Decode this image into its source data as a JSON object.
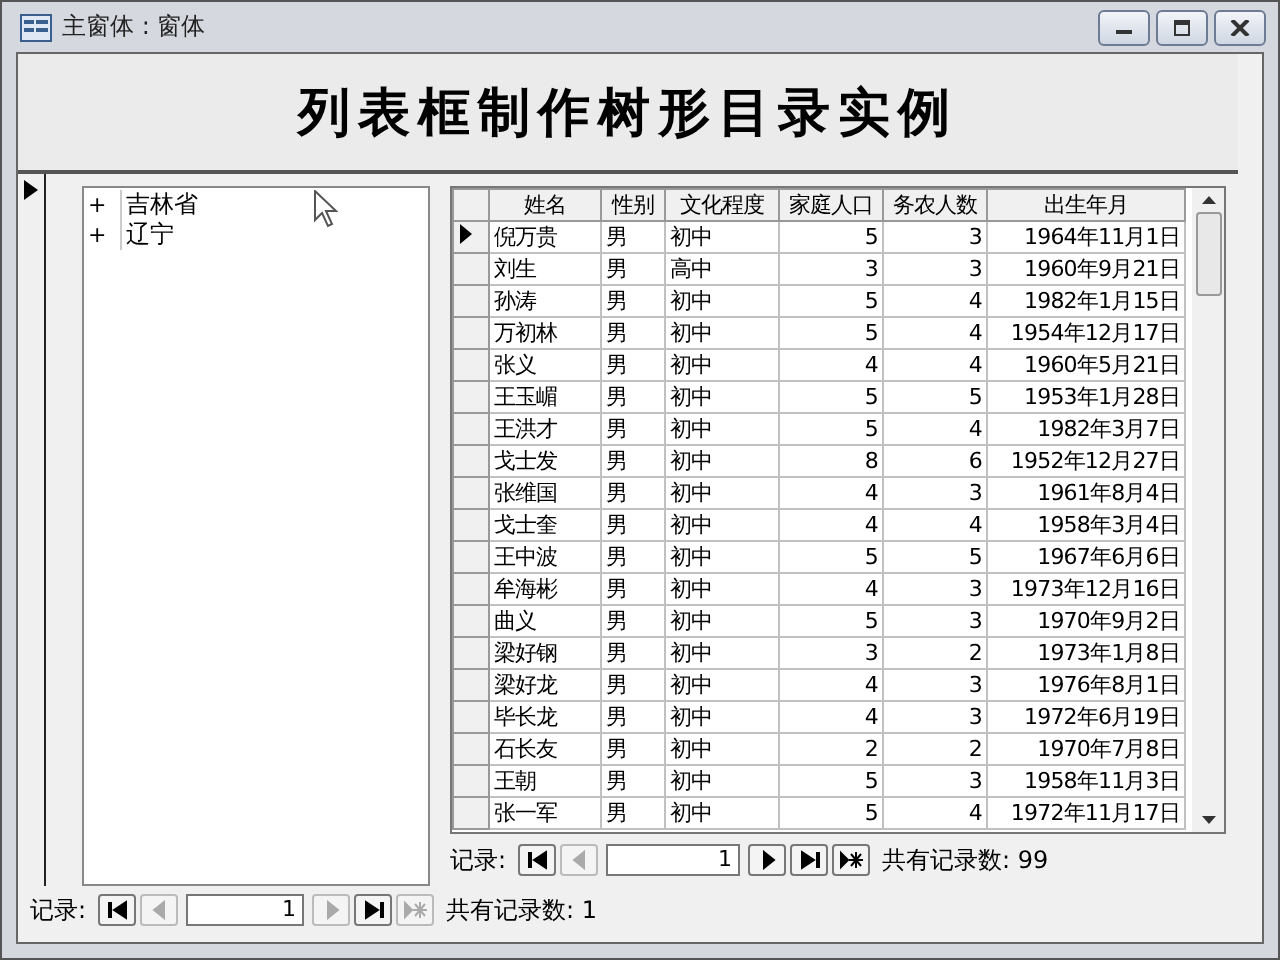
{
  "window": {
    "title": "主窗体 : 窗体"
  },
  "heading": "列表框制作树形目录实例",
  "tree": {
    "items": [
      {
        "toggle": "+",
        "label": "吉林省"
      },
      {
        "toggle": "+",
        "label": "辽宁"
      }
    ]
  },
  "datasheet": {
    "columns": [
      "姓名",
      "性别",
      "文化程度",
      "家庭人口",
      "务农人数",
      "出生年月"
    ],
    "rows": [
      {
        "selected": true,
        "cells": [
          "倪万贵",
          "男",
          "初中",
          "5",
          "3",
          "1964年11月1日"
        ]
      },
      {
        "selected": false,
        "cells": [
          "刘生",
          "男",
          "高中",
          "3",
          "3",
          "1960年9月21日"
        ]
      },
      {
        "selected": false,
        "cells": [
          "孙涛",
          "男",
          "初中",
          "5",
          "4",
          "1982年1月15日"
        ]
      },
      {
        "selected": false,
        "cells": [
          "万初林",
          "男",
          "初中",
          "5",
          "4",
          "1954年12月17日"
        ]
      },
      {
        "selected": false,
        "cells": [
          "张义",
          "男",
          "初中",
          "4",
          "4",
          "1960年5月21日"
        ]
      },
      {
        "selected": false,
        "cells": [
          "王玉嵋",
          "男",
          "初中",
          "5",
          "5",
          "1953年1月28日"
        ]
      },
      {
        "selected": false,
        "cells": [
          "王洪才",
          "男",
          "初中",
          "5",
          "4",
          "1982年3月7日"
        ]
      },
      {
        "selected": false,
        "cells": [
          "戈士发",
          "男",
          "初中",
          "8",
          "6",
          "1952年12月27日"
        ]
      },
      {
        "selected": false,
        "cells": [
          "张维国",
          "男",
          "初中",
          "4",
          "3",
          "1961年8月4日"
        ]
      },
      {
        "selected": false,
        "cells": [
          "戈士奎",
          "男",
          "初中",
          "4",
          "4",
          "1958年3月4日"
        ]
      },
      {
        "selected": false,
        "cells": [
          "王中波",
          "男",
          "初中",
          "5",
          "5",
          "1967年6月6日"
        ]
      },
      {
        "selected": false,
        "cells": [
          "牟海彬",
          "男",
          "初中",
          "4",
          "3",
          "1973年12月16日"
        ]
      },
      {
        "selected": false,
        "cells": [
          "曲义",
          "男",
          "初中",
          "5",
          "3",
          "1970年9月2日"
        ]
      },
      {
        "selected": false,
        "cells": [
          "梁好钢",
          "男",
          "初中",
          "3",
          "2",
          "1973年1月8日"
        ]
      },
      {
        "selected": false,
        "cells": [
          "梁好龙",
          "男",
          "初中",
          "4",
          "3",
          "1976年8月1日"
        ]
      },
      {
        "selected": false,
        "cells": [
          "毕长龙",
          "男",
          "初中",
          "4",
          "3",
          "1972年6月19日"
        ]
      },
      {
        "selected": false,
        "cells": [
          "石长友",
          "男",
          "初中",
          "2",
          "2",
          "1970年7月8日"
        ]
      },
      {
        "selected": false,
        "cells": [
          "王朝",
          "男",
          "初中",
          "5",
          "3",
          "1958年11月3日"
        ]
      },
      {
        "selected": false,
        "cells": [
          "张一军",
          "男",
          "初中",
          "5",
          "4",
          "1972年11月17日"
        ]
      }
    ],
    "navigator": {
      "label": "记录:",
      "current": "1",
      "total": "共有记录数: 99",
      "buttons": [
        {
          "kind": "first",
          "disabled": false
        },
        {
          "kind": "prev",
          "disabled": true
        },
        {
          "kind": "next",
          "disabled": false
        },
        {
          "kind": "last",
          "disabled": false
        },
        {
          "kind": "new",
          "disabled": false
        }
      ]
    }
  },
  "form_navigator": {
    "label": "记录:",
    "current": "1",
    "total": "共有记录数: 1",
    "buttons": [
      {
        "kind": "first",
        "disabled": false
      },
      {
        "kind": "prev",
        "disabled": true
      },
      {
        "kind": "next",
        "disabled": true
      },
      {
        "kind": "last",
        "disabled": false
      },
      {
        "kind": "new",
        "disabled": true
      }
    ]
  }
}
